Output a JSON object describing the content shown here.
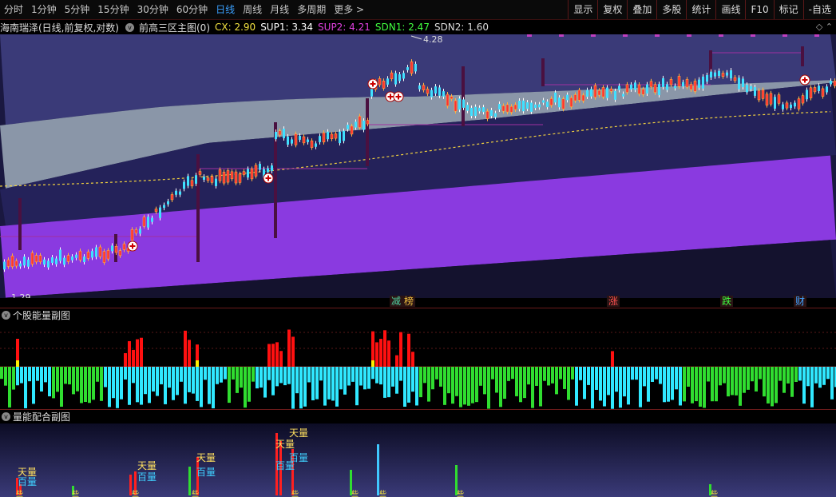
{
  "toolbar": {
    "periods": [
      "分时",
      "1分钟",
      "5分钟",
      "15分钟",
      "30分钟",
      "60分钟",
      "日线",
      "周线",
      "月线",
      "多周期",
      "更多 >"
    ],
    "active_index": 6,
    "tools": [
      "显示",
      "复权",
      "叠加",
      "多股",
      "统计",
      "画线",
      "F10",
      "标记",
      "-自选"
    ]
  },
  "main": {
    "stock": "海南瑞泽(日线,前复权,对数)",
    "indicator": "前高三区主图(0)",
    "cx": "CX: 2.90",
    "sup1": "SUP1: 3.34",
    "sup2": "SUP2: 4.21",
    "sdn1": "SDN1: 2.47",
    "sdn2": "SDN2: 1.60",
    "high_label": "4.28",
    "low_label": "1.29",
    "event_tags": [
      {
        "text": "减",
        "color": "#4fd0a0"
      },
      {
        "text": "榜",
        "color": "#f0c040"
      },
      {
        "text": "涨",
        "color": "#ff5050"
      },
      {
        "text": "跌",
        "color": "#40ff40"
      },
      {
        "text": "财",
        "color": "#40a0ff"
      }
    ]
  },
  "volume_panel": {
    "title": "个股能量副图"
  },
  "energy_panel": {
    "title": "量能配合副图",
    "labels": [
      {
        "text": "天量",
        "color": "#ffe060"
      },
      {
        "text": "百量",
        "color": "#40d0ff"
      },
      {
        "text": "天量",
        "color": "#ffe060"
      },
      {
        "text": "百量",
        "color": "#40d0ff"
      },
      {
        "text": "天量",
        "color": "#ffe060"
      },
      {
        "text": "百量",
        "color": "#40d0ff"
      },
      {
        "text": "天量",
        "color": "#ffe060"
      },
      {
        "text": "百量",
        "color": "#40d0ff"
      },
      {
        "text": "天量",
        "color": "#ffe060"
      },
      {
        "text": "百量",
        "color": "#40d0ff"
      }
    ],
    "bottom_mark": "些"
  },
  "colors": {
    "up": "#ff3030",
    "down": "#40e0ff",
    "zone_grey": "#8a96a8",
    "zone_purple": "#8a3ae0",
    "bar_green": "#30dd30",
    "bar_cyan": "#30e8ff"
  }
}
